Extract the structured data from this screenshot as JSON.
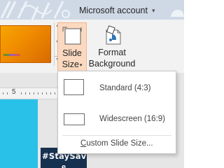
{
  "titlebar": {
    "account_label": "Microsoft account",
    "background_color": "#cfd9e6",
    "account_chevron_icon": "chevron-down-icon"
  },
  "ribbon": {
    "theme_gallery": {
      "thumbnail_colors": [
        "#f7a600",
        "#d96a00"
      ],
      "scroll_up_icon": "triangle-up-icon",
      "scroll_down_icon": "triangle-down-icon"
    },
    "slide_size": {
      "label_line1": "Slide",
      "label_line2": "Size",
      "icon": "slide-size-icon",
      "active_color": "#fbd9c0",
      "caret": "▾"
    },
    "format_background": {
      "label_line1": "Format",
      "label_line2": "Background",
      "icon": "format-background-icon"
    }
  },
  "ruler": {
    "number": "5"
  },
  "slide": {
    "hashtag_text": "#StaySave",
    "hashtag_text_line2": "e",
    "background_color": "#29c1e8",
    "box_color": "#16304f"
  },
  "slide_size_menu": {
    "items": [
      {
        "label": "Standard (4:3)",
        "icon": "standard-aspect-icon"
      },
      {
        "label": "Widescreen (16:9)",
        "icon": "widescreen-aspect-icon"
      }
    ],
    "custom_label_mnemonic": "C",
    "custom_label_rest": "ustom Slide Size..."
  }
}
